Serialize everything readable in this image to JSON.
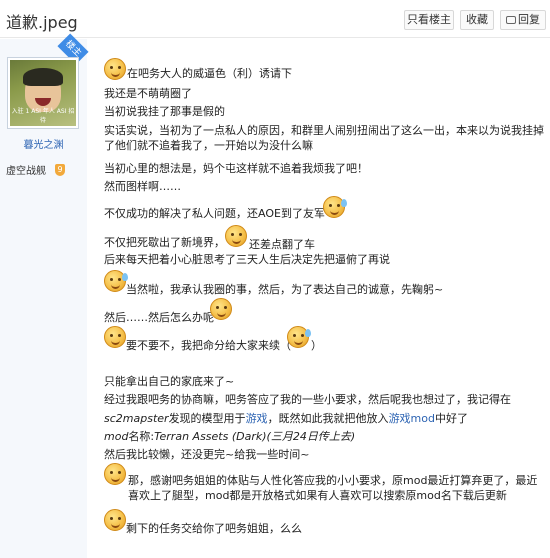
{
  "header": {
    "title": "道歉.jpeg",
    "only_author_label": "只看楼主",
    "favorite_label": "收藏",
    "reply_label": "回复"
  },
  "sidebar": {
    "op_badge": "楼主",
    "avatar_caption": "入驻 1 ASI 年人 ASI 招待",
    "username": "暮光之渊",
    "forum_badge": "虚空战舰",
    "level": "9"
  },
  "post": {
    "l1": "在吧务大人的威逼色（利）诱请下",
    "l2": "我还是不萌萌圈了",
    "l3": "当初说我挂了那事是假的",
    "l4": "实话实说，当初为了一点私人的原因，和群里人闹别扭闹出了这么一出，本来以为说我挂掉了他们就不追着我了，一开始以为没什么嘛",
    "l5": "当初心里的想法是，妈个屯这样就不追着我烦我了吧！",
    "l6": "然而图样啊……",
    "l7": "不仅成功的解决了私人问题，还AOE到了友军",
    "l8": "不仅把死歇出了新境界，",
    "l8b": "还差点翻了车",
    "l9": "后来每天把着小心脏思考了三天人生后决定先把逼俯了再说",
    "l10": "当然啦，我承认我圈的事，然后，为了表达自己的诚意，先鞠躬~",
    "l11": "然后……然后怎么办呢",
    "l12a": "要不要不，我把命分给大家来续（",
    "l12b": "）",
    "l13": "只能拿出自己的家底来了~",
    "l14": "经过我跟吧务的协商嘛，吧务答应了我的一些小要求，然后呢我也想过了，我记得在",
    "l15a": "sc2mapster",
    "l15b": "发现的模型用于",
    "l15c": "游戏",
    "l15d": "，既然如此我就把他放入",
    "l15e": "游戏mod",
    "l15f": "中好了",
    "l16a": "mod",
    "l16b": "名称:",
    "l16c": "Terran Assets (Dark)",
    "l16d": "(三月24日传上去)",
    "l17": "然后我比较懒，还没更完~给我一些时间~",
    "l18": "那，感谢吧务姐姐的体贴与人性化答应我的小小要求，原mod最近打算弃更了，最近喜欢上了腿型，mod都是开放格式如果有人喜欢可以搜索原mod名下载后更新",
    "l19": "剩下的任务交给你了吧务姐姐，么么"
  },
  "colors": {
    "link": "#2d64b3",
    "op_badge": "#3f8ce6",
    "level": "#f2a93b"
  }
}
